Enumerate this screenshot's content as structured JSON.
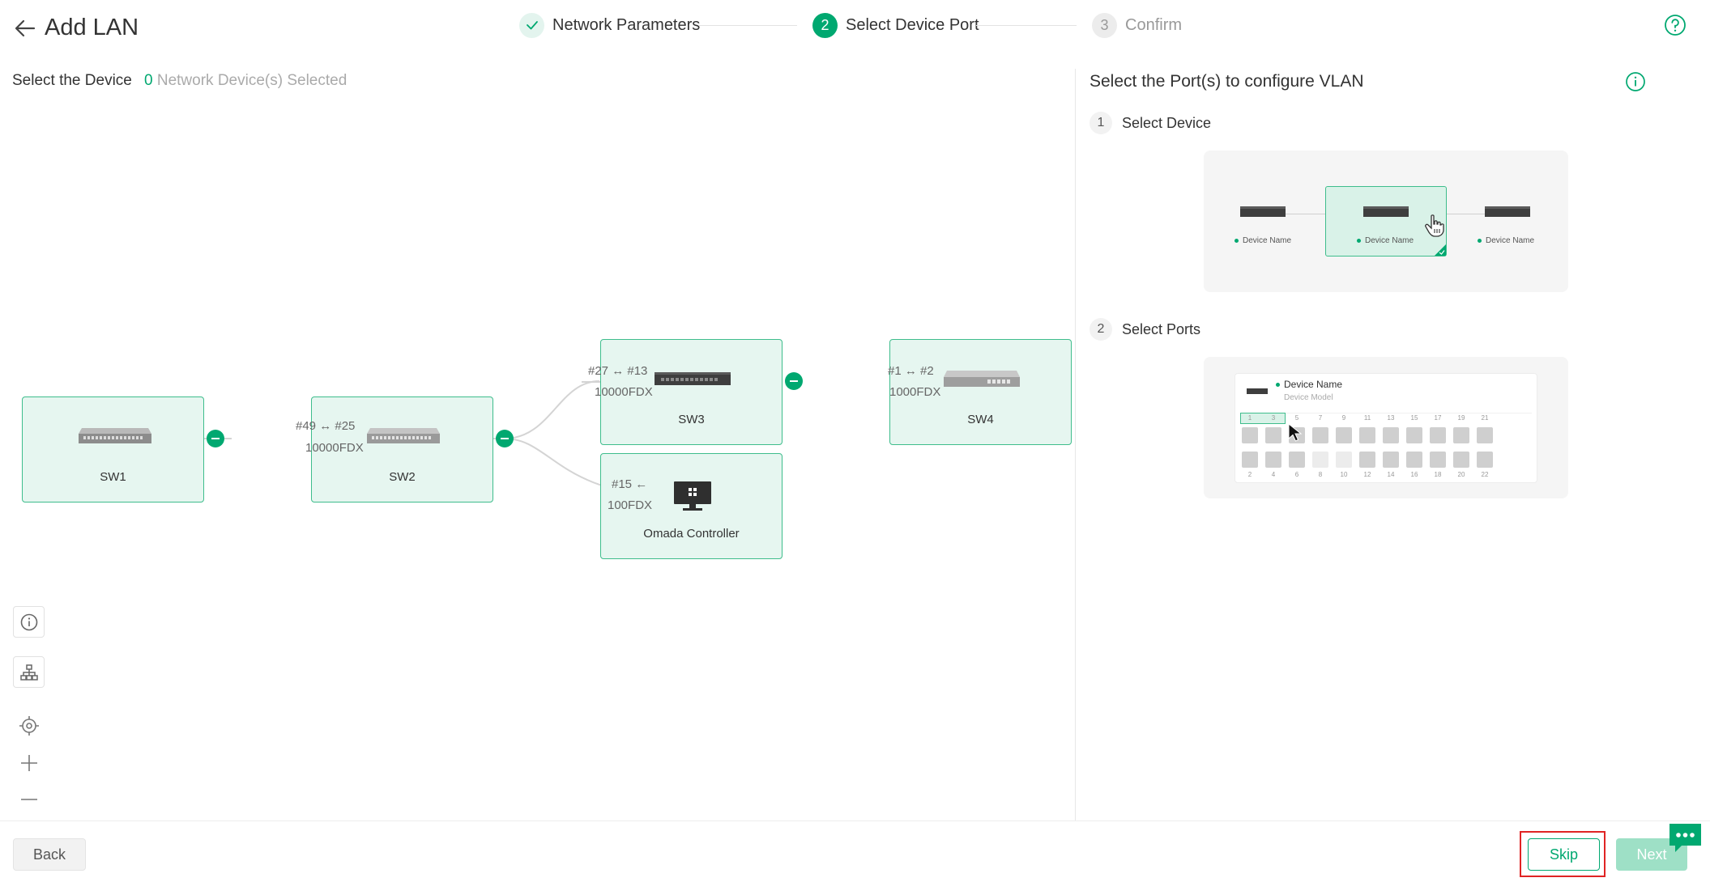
{
  "header": {
    "title": "Add LAN",
    "steps": [
      {
        "num": "",
        "label": "Network Parameters"
      },
      {
        "num": "2",
        "label": "Select Device Port"
      },
      {
        "num": "3",
        "label": "Confirm"
      }
    ]
  },
  "left": {
    "select_label": "Select the Device",
    "selected_count": "0",
    "selected_suffix": " Network Device(s) Selected",
    "devices": [
      {
        "name": "SW1"
      },
      {
        "name": "SW2",
        "port": "#49 ↔ #25",
        "speed": "10000FDX"
      },
      {
        "name": "SW3",
        "port": "#27 ↔ #13",
        "speed": "10000FDX"
      },
      {
        "name": "SW4",
        "port": "#1 ↔ #2",
        "speed": "1000FDX"
      },
      {
        "name": "Omada Controller",
        "port": "#15 ←",
        "speed": "100FDX"
      }
    ]
  },
  "right": {
    "title": "Select the Port(s) to configure VLAN",
    "step1": {
      "num": "1",
      "label": "Select Device"
    },
    "step2": {
      "num": "2",
      "label": "Select Ports"
    },
    "demo1": {
      "device_labels": [
        "Device Name",
        "Device Name",
        "Device Name"
      ]
    },
    "demo2": {
      "device_name": "Device Name",
      "device_model": "Device Model",
      "top_ports": [
        "1",
        "3",
        "5",
        "7",
        "9",
        "11",
        "13",
        "15",
        "17",
        "19",
        "21"
      ],
      "bottom_ports": [
        "2",
        "4",
        "6",
        "8",
        "10",
        "12",
        "14",
        "16",
        "18",
        "20",
        "22"
      ]
    }
  },
  "footer": {
    "back_label": "Back",
    "skip_label": "Skip",
    "next_label": "Next"
  },
  "colors": {
    "accent": "#00a870",
    "node_fill": "#e6f6f0",
    "node_border": "#3ebd8c",
    "highlight": "#e02424"
  }
}
